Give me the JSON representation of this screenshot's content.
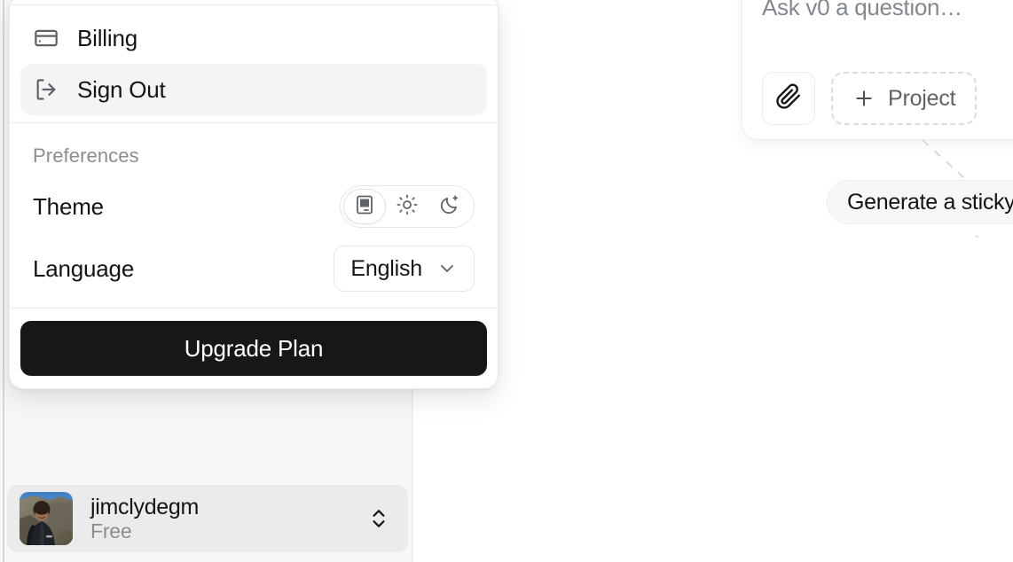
{
  "account_menu": {
    "items": [
      {
        "id": "billing",
        "label": "Billing",
        "icon": "credit-card-icon",
        "active": false
      },
      {
        "id": "sign-out",
        "label": "Sign Out",
        "icon": "log-out-icon",
        "active": true
      }
    ],
    "preferences": {
      "heading": "Preferences",
      "theme": {
        "label": "Theme",
        "selected": "system",
        "options": [
          {
            "id": "system",
            "icon": "monitor-icon",
            "selected": true
          },
          {
            "id": "light",
            "icon": "sun-icon",
            "selected": false
          },
          {
            "id": "dark",
            "icon": "moon-icon",
            "selected": false
          }
        ]
      },
      "language": {
        "label": "Language",
        "value": "English",
        "chevron_icon": "chevron-down-icon"
      }
    },
    "upgrade_label": "Upgrade Plan"
  },
  "user": {
    "name": "jimclydegm",
    "plan": "Free",
    "avatar_alt": "user-avatar-photo",
    "chevron_icon": "chevrons-up-down-icon"
  },
  "canvas": {
    "prompt_card": {
      "placeholder": "Ask v0 a question…",
      "attach_icon": "paperclip-icon",
      "project_button": {
        "label": "Project",
        "icon": "plus-icon"
      }
    },
    "suggestion_chip": {
      "label": "Generate a sticky"
    }
  },
  "colors": {
    "accent_dark": "#171717",
    "panel_bg": "#ffffff",
    "sidebar_bg": "#f7f7f7",
    "muted_text": "#8a8d93",
    "active_item_bg": "#f4f4f4",
    "user_row_bg": "#ebebeb"
  }
}
